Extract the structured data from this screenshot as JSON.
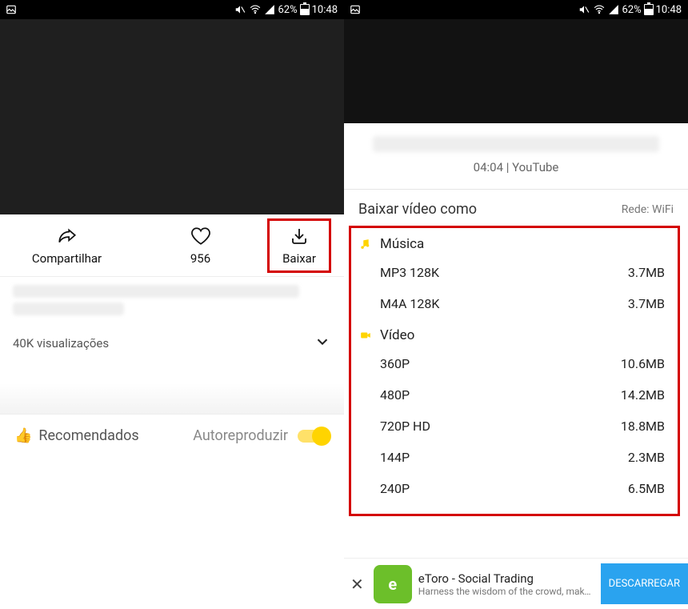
{
  "status": {
    "battery_pct": "62%",
    "time": "10:48"
  },
  "left": {
    "share_label": "Compartilhar",
    "likes": "956",
    "download_label": "Baixar",
    "views": "40K visualizações",
    "recommended": "Recomendados",
    "autoplay": "Autoreproduzir"
  },
  "right": {
    "duration_source": "04:04 | YouTube",
    "download_as": "Baixar vídeo como",
    "network": "Rede: WiFi",
    "music_header": "Música",
    "video_header": "Vídeo",
    "music": [
      {
        "label": "MP3 128K",
        "size": "3.7MB"
      },
      {
        "label": "M4A 128K",
        "size": "3.7MB"
      }
    ],
    "video": [
      {
        "label": "360P",
        "size": "10.6MB"
      },
      {
        "label": "480P",
        "size": "14.2MB"
      },
      {
        "label": "720P HD",
        "size": "18.8MB"
      },
      {
        "label": "144P",
        "size": "2.3MB"
      },
      {
        "label": "240P",
        "size": "6.5MB"
      }
    ],
    "ad": {
      "title": "eToro - Social Trading",
      "subtitle": "Harness the wisdom of the crowd, make smarter investment …",
      "cta": "DESCARREGAR"
    }
  }
}
